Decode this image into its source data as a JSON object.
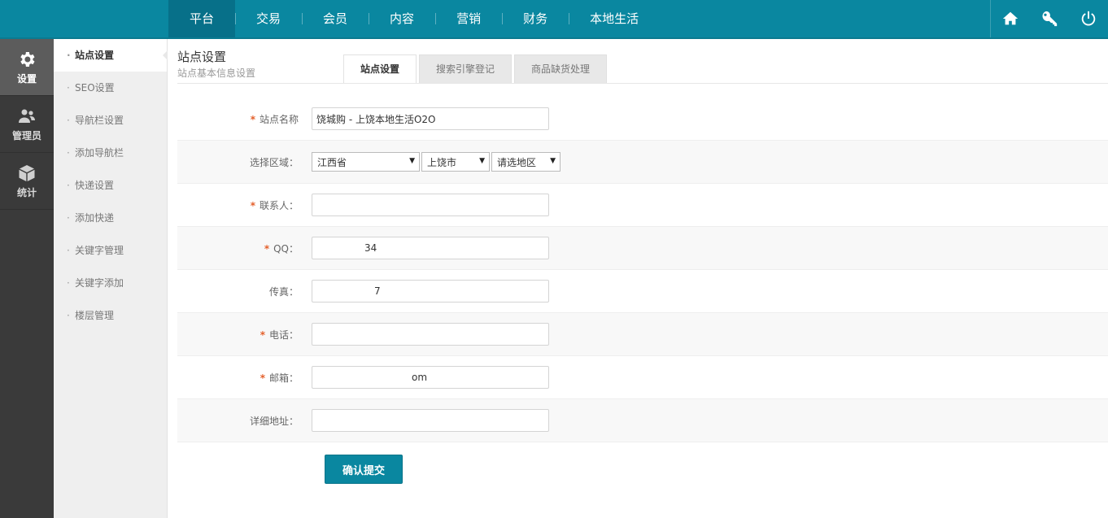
{
  "topnav": [
    "平台",
    "交易",
    "会员",
    "内容",
    "营销",
    "财务",
    "本地生活"
  ],
  "topicons": [
    "home-icon",
    "key-icon",
    "power-icon"
  ],
  "rail": [
    {
      "label": "设置",
      "icon": "gear-icon"
    },
    {
      "label": "管理员",
      "icon": "users-icon"
    },
    {
      "label": "统计",
      "icon": "cube-icon"
    }
  ],
  "sidebar": [
    "站点设置",
    "SEO设置",
    "导航栏设置",
    "添加导航栏",
    "快递设置",
    "添加快递",
    "关键字管理",
    "关键字添加",
    "楼层管理"
  ],
  "page": {
    "title": "站点设置",
    "subtitle": "站点基本信息设置"
  },
  "tabs": [
    "站点设置",
    "搜索引擎登记",
    "商品缺货处理"
  ],
  "form": {
    "site_name": {
      "label": "站点名称",
      "value": "饶城购 - 上饶本地生活O2O"
    },
    "region": {
      "label": "选择区域：",
      "province": "江西省",
      "city": "上饶市",
      "district": "请选地区"
    },
    "contact": {
      "label": "联系人：",
      "value": ""
    },
    "qq": {
      "label": "QQ：",
      "value": "34"
    },
    "fax": {
      "label": "传真：",
      "value": "7"
    },
    "phone": {
      "label": "电话：",
      "value": ""
    },
    "email": {
      "label": "邮箱：",
      "value": "om"
    },
    "address": {
      "label": "详细地址：",
      "value": ""
    },
    "submit": "确认提交"
  },
  "colors": {
    "primary": "#0a87a0",
    "required": "#e4602b"
  }
}
